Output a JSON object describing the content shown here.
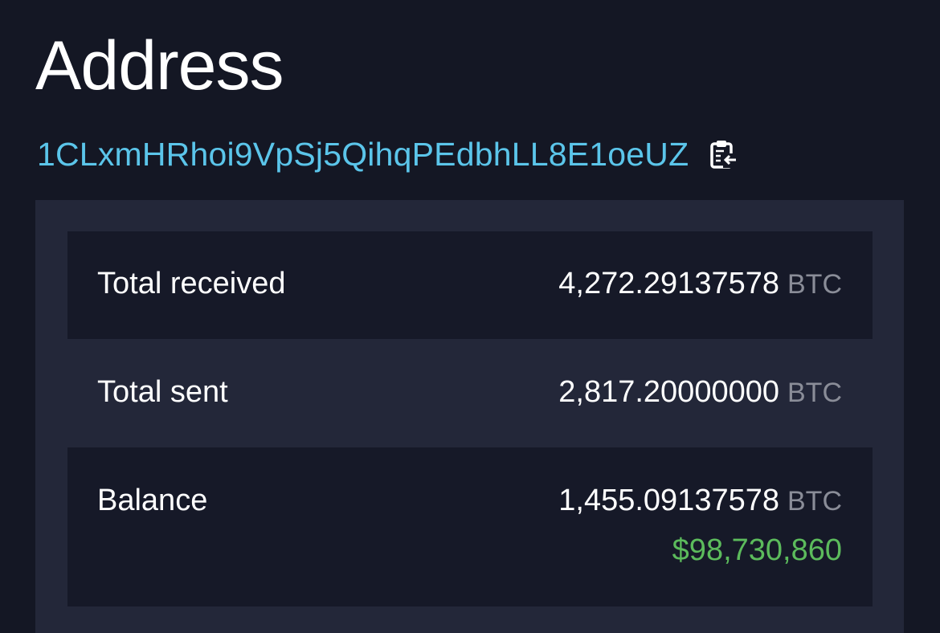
{
  "title": "Address",
  "address": {
    "value": "1CLxmHRhoi9VpSj5QihqPEdbhLL8E1oeUZ",
    "copy_icon": "clipboard-copy-icon"
  },
  "summary": {
    "rows": [
      {
        "label": "Total received",
        "amount": "4,272.29137578",
        "unit": "BTC"
      },
      {
        "label": "Total sent",
        "amount": "2,817.20000000",
        "unit": "BTC"
      },
      {
        "label": "Balance",
        "amount": "1,455.09137578",
        "unit": "BTC",
        "usd": "$98,730,860"
      }
    ]
  },
  "colors": {
    "background": "#141724",
    "panel": "#232739",
    "row_dark": "#161928",
    "address_link": "#5bc5ea",
    "usd_value": "#5cbb5c",
    "unit_text": "#8a8d98"
  }
}
